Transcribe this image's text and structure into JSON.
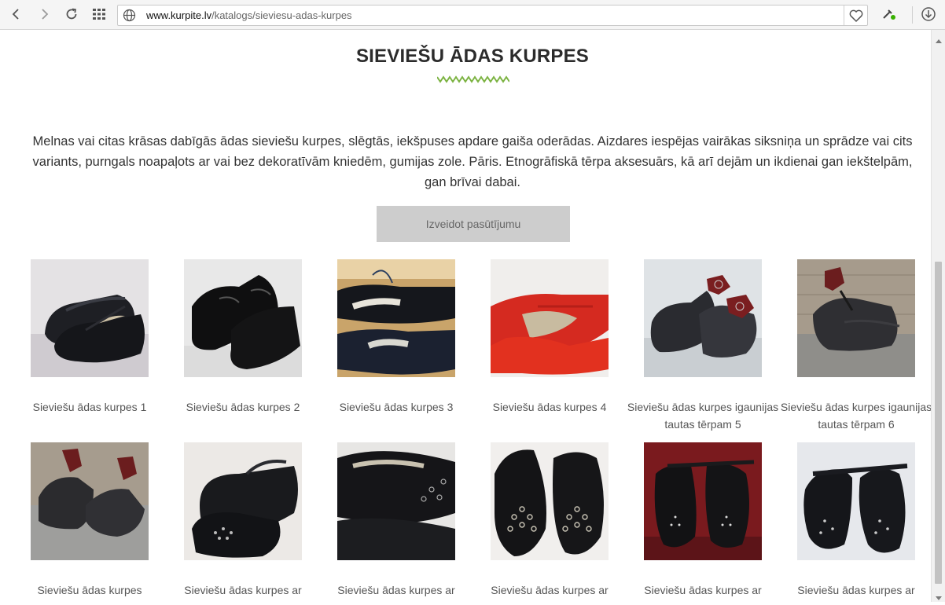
{
  "browser": {
    "url_domain": "www.kurpite.lv",
    "url_path": "/katalogs/sieviesu-adas-kurpes",
    "icons": [
      "back-icon",
      "forward-icon",
      "reload-icon",
      "speed-dial-icon",
      "globe-icon",
      "heart-icon",
      "extension-icon",
      "download-icon"
    ]
  },
  "page": {
    "title": "SIEVIEŠU ĀDAS KURPES",
    "description": "Melnas vai citas krāsas dabīgās ādas sieviešu kurpes, slēgtās, iekšpuses apdare gaiša oderādas. Aizdares iespējas vairākas siksniņa un sprādze vai cits variants, purngals noapaļots ar vai bez dekoratīvām kniedēm, gumijas zole. Pāris. Etnogrāfiskā tērpa aksesuārs, kā arī dejām un ikdienai gan iekštelpām, gan brīvai dabai.",
    "order_button": "Izveidot pasūtījumu",
    "accent_color": "#7cb342"
  },
  "products": [
    {
      "name": "Sieviešu ādas kurpes 1"
    },
    {
      "name": "Sieviešu ādas kurpes 2"
    },
    {
      "name": "Sieviešu ādas kurpes 3"
    },
    {
      "name": "Sieviešu ādas kurpes 4"
    },
    {
      "name": "Sieviešu ādas kurpes igaunijas tautas tērpam 5"
    },
    {
      "name": "Sieviešu ādas kurpes igaunijas tautas tērpam 6"
    },
    {
      "name": "Sieviešu ādas kurpes"
    },
    {
      "name": "Sieviešu ādas kurpes ar"
    },
    {
      "name": "Sieviešu ādas kurpes ar"
    },
    {
      "name": "Sieviešu ādas kurpes ar"
    },
    {
      "name": "Sieviešu ādas kurpes ar"
    },
    {
      "name": "Sieviešu ādas kurpes ar"
    }
  ]
}
